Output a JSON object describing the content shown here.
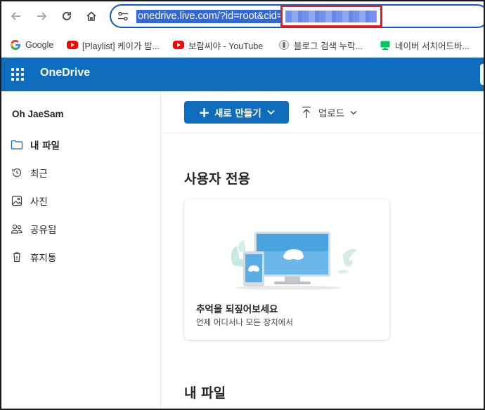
{
  "browser": {
    "url_visible": "onedrive.live.com/?id=root&cid=",
    "bookmarks": [
      {
        "label": "Google",
        "icon": "google-icon"
      },
      {
        "label": "[Playlist] 케이가 밤...",
        "icon": "youtube-icon"
      },
      {
        "label": "보람씨야 - YouTube",
        "icon": "youtube-icon"
      },
      {
        "label": "블로그 검색 누락...",
        "icon": "blog-icon"
      },
      {
        "label": "네이버 서치어드바...",
        "icon": "naver-monitor-icon"
      }
    ]
  },
  "app": {
    "title": "OneDrive",
    "accent_color": "#0f6cbd"
  },
  "sidebar": {
    "user_name": "Oh JaeSam",
    "items": [
      {
        "label": "내 파일",
        "icon": "folder-icon",
        "active": true
      },
      {
        "label": "최근",
        "icon": "history-icon",
        "active": false
      },
      {
        "label": "사진",
        "icon": "image-icon",
        "active": false
      },
      {
        "label": "공유됨",
        "icon": "people-icon",
        "active": false
      },
      {
        "label": "휴지통",
        "icon": "recycle-bin-icon",
        "active": false
      }
    ]
  },
  "toolbar": {
    "new_label": "새로 만들기",
    "upload_label": "업로드"
  },
  "main": {
    "section_for_you": "사용자 전용",
    "card_title": "추억을 되짚어보세요",
    "card_subtitle": "언제 어디서나 모든 장치에서",
    "section_my_files": "내 파일"
  }
}
